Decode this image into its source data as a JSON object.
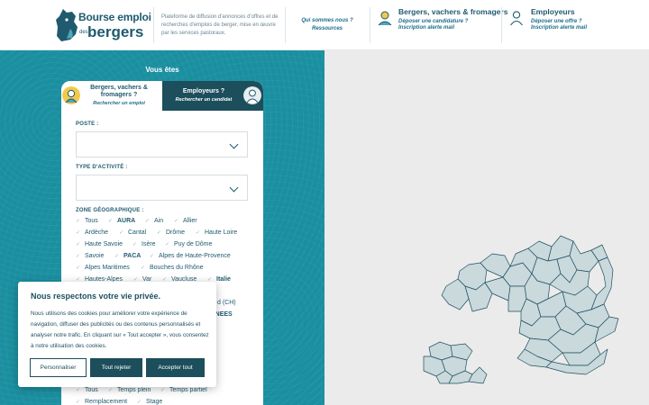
{
  "header": {
    "logo_line1": "Bourse emploi",
    "logo_des": "des",
    "logo_line2": "bergers",
    "tagline": "Plateforme de diffusion d'annonces d'offres et de recherches d'emplois de berger, mise en œuvre par les services pastoraux.",
    "about_link": "Qui sommes nous ?",
    "resources_link": "Ressources",
    "bergers_title": "Bergers, vachers & fromagers",
    "bergers_link1": "Déposer une candidature ?",
    "bergers_link2": "Inscription alerte mail",
    "employeurs_title": "Employeurs",
    "employeurs_link1": "Déposer une offre ?",
    "employeurs_link2": "Inscription alerte mail"
  },
  "search": {
    "heading": "Vous êtes",
    "tab_bergers_title": "Bergers, vachers & fromagers ?",
    "tab_bergers_sub": "Rechercher un emploi",
    "tab_employeurs_title": "Employeurs ?",
    "tab_employeurs_sub": "Rechercher un candidat",
    "poste_label": "POSTE :",
    "activite_label": "TYPE D'ACTIVITÉ :",
    "zone_label": "ZONE GÉOGRAPHIQUE :",
    "zones": {
      "tous": "Tous",
      "aura": "AURA",
      "ain": "Ain",
      "allier": "Allier",
      "ardeche": "Ardèche",
      "cantal": "Cantal",
      "drome": "Drôme",
      "haute_loire": "Haute Loire",
      "haute_savoie": "Haute Savoie",
      "isere": "Isère",
      "puy_de_dome": "Puy de Dôme",
      "savoie": "Savoie",
      "paca": "PACA",
      "alpes_hp": "Alpes de Haute-Provence",
      "alpes_maritimes": "Alpes Maritimes",
      "bouches_rhone": "Bouches du Rhône",
      "hautes_alpes": "Hautes-Alpes",
      "var": "Var",
      "vaucluse": "Vaucluse",
      "italie": "Italie",
      "suisse_fragment": "d (CH)",
      "pyrenees_fragment": "ENEES"
    },
    "contrat": {
      "tous": "Tous",
      "temps_plein": "Temps plein",
      "temps_partiel": "Temps partiel",
      "remplacement": "Remplacement",
      "stage": "Stage"
    }
  },
  "cookie": {
    "title": "Nous respectons votre vie privée.",
    "text": "Nous utilisons des cookies pour améliorer votre expérience de navigation, diffuser des publicités ou des contenus personnalisés et analyser notre trafic. En cliquant sur « Tout accepter », vous consentez à notre utilisation des cookies.",
    "btn_customize": "Personnaliser",
    "btn_reject": "Tout rejeter",
    "btn_accept": "Accepter tout"
  },
  "colors": {
    "teal": "#1a8fa0",
    "dark_teal": "#1c4e5c",
    "map_fill": "#c9d9dc",
    "map_stroke": "#1f4f60"
  }
}
